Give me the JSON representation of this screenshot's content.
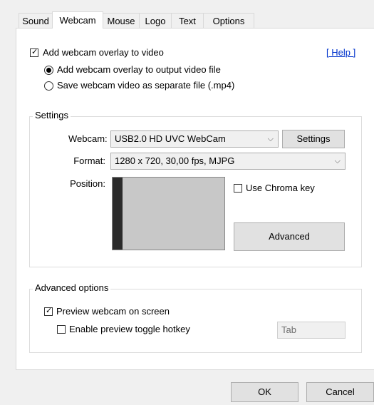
{
  "tabs": [
    "Sound",
    "Webcam",
    "Mouse",
    "Logo",
    "Text",
    "Options"
  ],
  "overlay": {
    "add_label": "Add webcam overlay to video",
    "help_link": "[ Help ]",
    "radio_output_label": "Add webcam overlay to output video file",
    "radio_separate_label": "Save webcam video as separate file (.mp4)",
    "add_checked": true,
    "selected_radio": "output"
  },
  "settings": {
    "group_title": "Settings",
    "webcam_label": "Webcam:",
    "webcam_value": "USB2.0 HD UVC WebCam",
    "settings_button": "Settings",
    "format_label": "Format:",
    "format_value": "1280 x 720, 30,00 fps, MJPG",
    "position_label": "Position:",
    "chroma_label": "Use Chroma key",
    "chroma_checked": false,
    "advanced_button": "Advanced"
  },
  "advanced_options": {
    "group_title": "Advanced options",
    "preview_label": "Preview webcam on screen",
    "preview_checked": true,
    "hotkey_label": "Enable preview toggle hotkey",
    "hotkey_checked": false,
    "hotkey_value": "Tab"
  },
  "footer": {
    "ok_label": "OK",
    "cancel_label": "Cancel"
  }
}
